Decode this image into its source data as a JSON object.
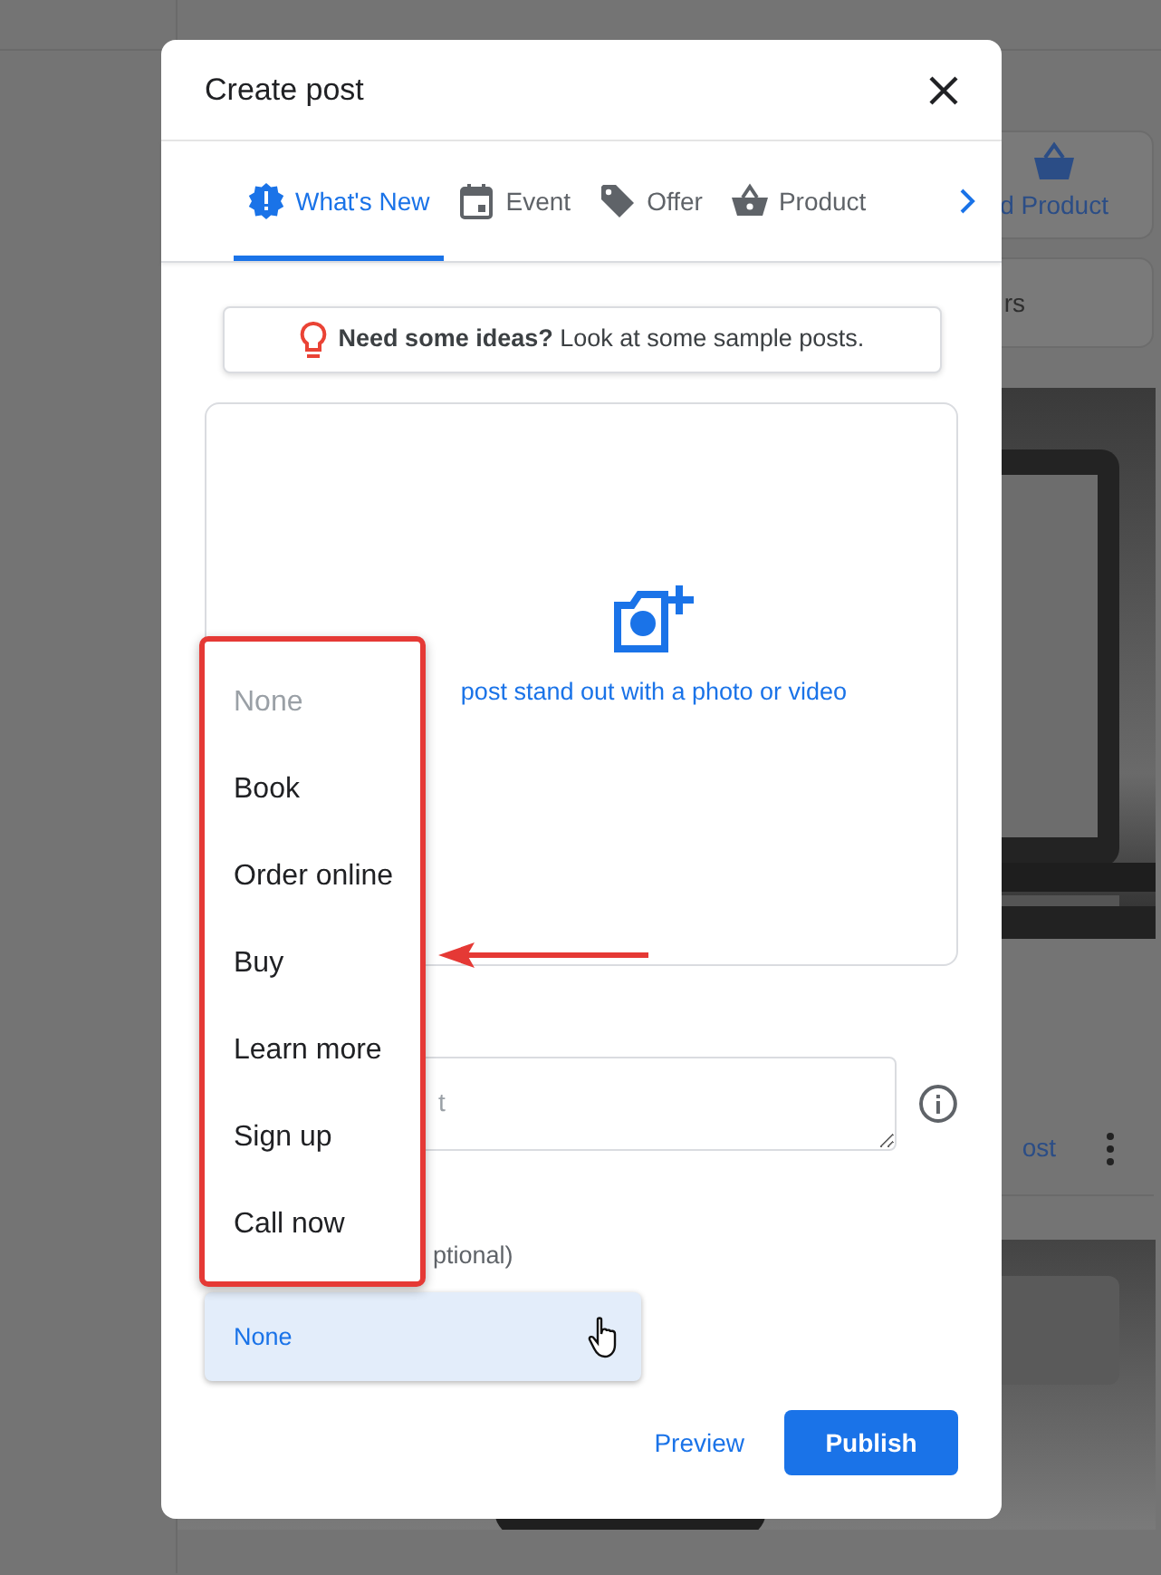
{
  "background_page": {
    "action_button": "d Product",
    "filter_button": "rs",
    "post_link": "ost"
  },
  "dialog": {
    "title": "Create post",
    "tabs": [
      {
        "label": "What's New",
        "selected": true
      },
      {
        "label": "Event",
        "selected": false
      },
      {
        "label": "Offer",
        "selected": false
      },
      {
        "label": "Product",
        "selected": false
      }
    ],
    "ideas_banner": "**Need some ideas?** Look at some sample posts.",
    "photo_prompt": "post stand out with a photo or video",
    "description": {
      "placeholder": "t"
    },
    "button_label": "ptional)",
    "button_select": {
      "value": "None"
    },
    "menu": [
      {
        "label": "None",
        "disabled": true
      },
      {
        "label": "Book",
        "disabled": false
      },
      {
        "label": "Order online",
        "disabled": false
      },
      {
        "label": "Buy",
        "disabled": false
      },
      {
        "label": "Learn more",
        "disabled": false
      },
      {
        "label": "Sign up",
        "disabled": false
      },
      {
        "label": "Call now",
        "disabled": false
      }
    ],
    "footer": {
      "preview": "Preview",
      "publish": "Publish"
    }
  }
}
